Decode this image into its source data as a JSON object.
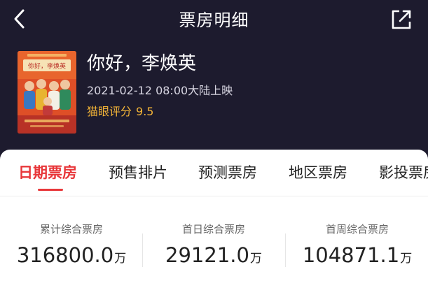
{
  "header": {
    "title": "票房明细",
    "back_icon": "chevron-left-icon",
    "share_icon": "share-icon"
  },
  "movie": {
    "title": "你好，李焕英",
    "release": "2021-02-12 08:00大陆上映",
    "rating_label": "猫眼评分",
    "rating_value": "9.5",
    "poster_title": "你好，李焕英",
    "colors": {
      "rating": "#f3b437",
      "background": "#1d1b2e"
    }
  },
  "tabs": [
    {
      "label": "日期票房",
      "active": true
    },
    {
      "label": "预售排片",
      "active": false
    },
    {
      "label": "预测票房",
      "active": false
    },
    {
      "label": "地区票房",
      "active": false
    },
    {
      "label": "影投票房",
      "active": false
    }
  ],
  "stats": [
    {
      "label": "累计综合票房",
      "value": "316800.0",
      "unit": "万"
    },
    {
      "label": "首日综合票房",
      "value": "29121.0",
      "unit": "万"
    },
    {
      "label": "首周综合票房",
      "value": "104871.1",
      "unit": "万"
    }
  ],
  "accent_color": "#e8373a"
}
